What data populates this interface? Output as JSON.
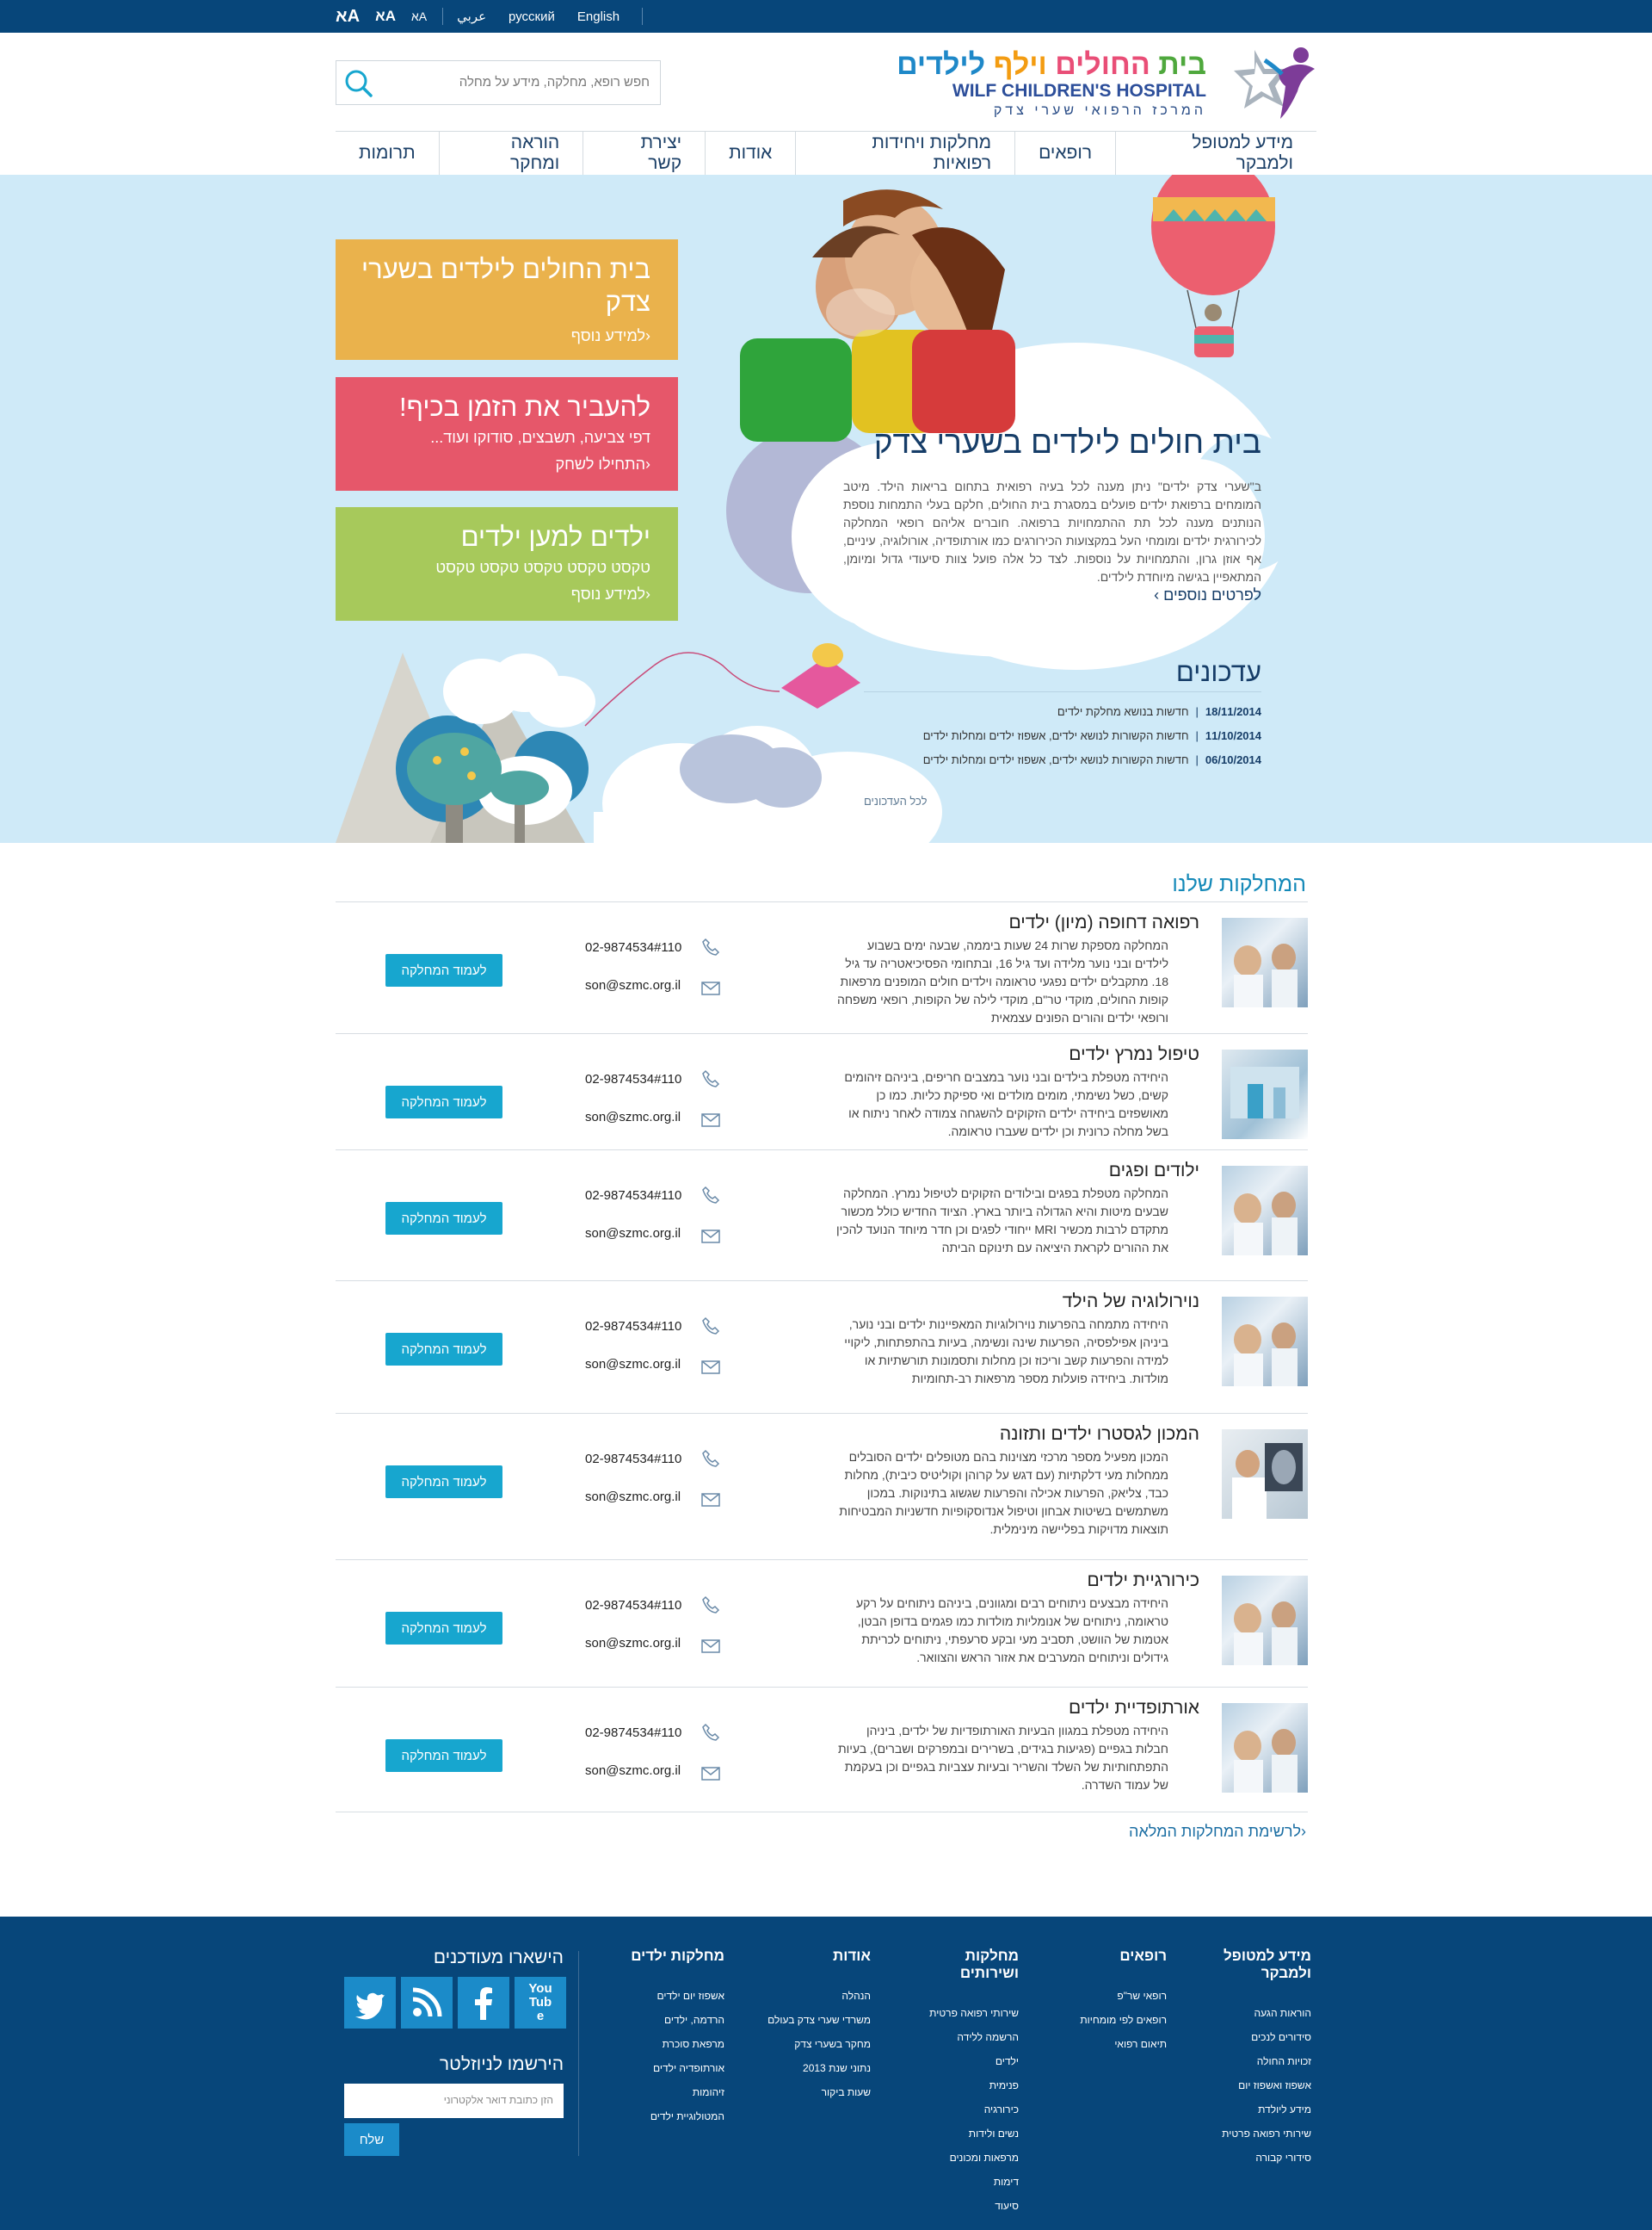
{
  "topbar": {
    "font_sizes": [
      "אA",
      "אA",
      "אA"
    ],
    "languages": [
      "عربي",
      "русский",
      "English"
    ]
  },
  "header": {
    "logo": {
      "title_he": "בית החולים וילף לילדים",
      "title_en": "WILF CHILDREN'S HOSPITAL",
      "subtitle_he": "המרכז הרפואי שערי צדק"
    },
    "search": {
      "placeholder": "חפש רופא, מחלקה, מידע על מחלה"
    }
  },
  "nav": [
    "מידע למטופל ולמבקר",
    "רופאים",
    "מחלקות ויחידות רפואיות",
    "אודות",
    "יצירת קשר",
    "הוראה ומחקר",
    "תרומות"
  ],
  "hero": {
    "boxes": [
      {
        "title": "בית החולים לילדים בשערי צדק",
        "sub": "",
        "more": "למידע נוסף"
      },
      {
        "title": "להעביר את הזמן בכיף!",
        "sub": "דפי צביעה, תשבצים, סודוקו ועוד...",
        "more": "התחילו לשחק"
      },
      {
        "title": "ילדים למען ילדים",
        "sub": "טקסט טקסט טקסט טקסט טקסט",
        "more": "למידע נוסף"
      }
    ],
    "cloud": {
      "title": "בית חולים לילדים בשערי צדק",
      "text": "ב\"שערי צדק ילדים\" ניתן מענה לכל בעיה רפואית בתחום בריאות הילד. מיטב המומחים ברפואת ילדים פועלים במסגרת בית החולים, חלקם בעלי התמחות נוספת הנותנים מענה לכל תת ההתמחויות ברפואה. חוברים אליהם רופאי המחלקה לכירורגית ילדים ומומחי העל במקצועות הכירורגים כמו אורתופדיה, אורולוגיה, עיניים, אף אוזן גרון, והתמחויות על נוספות. לצד כל אלה פועל צוות סיעודי גדול ומיומן, המתאפיין בגישה מיוחדת לילדים.",
      "more": "לפרטים נוספים"
    },
    "updates": {
      "title": "עדכונים",
      "items": [
        {
          "date": "18/11/2014",
          "text": "חדשות בנושא מחלקת ילדים"
        },
        {
          "date": "11/10/2014",
          "text": "חדשות הקשורות לנושא ילדים, אשפוז ילדים ומחלות ילדים"
        },
        {
          "date": "06/10/2014",
          "text": "חדשות הקשורות לנושא ילדים, אשפוז ילדים ומחלות ילדים"
        }
      ],
      "all": "לכל העדכונים"
    }
  },
  "departments": {
    "title": "המחלקות שלנו",
    "button_label": "לעמוד המחלקה",
    "items": [
      {
        "name": "רפואה דחופה (מיון) ילדים",
        "text": "המחלקה מספקת שרות 24 שעות ביממה, שבעה ימים בשבוע לילדים ובני נוער מלידה ועד גיל 16, ובתחומי הפסיכיאטריה עד גיל 18. מתקבלים ילדים נפגעי טראומה וילדים חולים המופנים מרפאות קופות החולים, מוקדי טר\"ם, מוקדי לילה של הקופות, רופאי משפחה ורופאי ילדים והורים הפונים עצמאית",
        "phone": "02-9874534#110",
        "email": "son@szmc.org.il"
      },
      {
        "name": "טיפול נמרץ ילדים",
        "text": "היחידה מטפלת בילדים ובני נוער במצבים חריפים, ביניהם זיהומים קשים, כשל נשימתי, מומים מולדים ואי ספיקת כליות. כמו כן מאושפזים ביחידה ילדים הזקוקים להשגחה צמודה לאחר ניתוח או בשל מחלה כרונית וכן ילדים שעברו טראומה.",
        "phone": "02-9874534#110",
        "email": "son@szmc.org.il"
      },
      {
        "name": "ילודים ופגים",
        "text": "המחלקה מטפלת בפגים ובילודים הזקוקים לטיפול נמרץ. המחלקה שבעים מיטות והיא הגדולה ביותר בארץ. הציוד החדיש כולל מכשור מתקדם לרבות מכשיר MRI ייחודי לפגים וכן חדר מיוחד הנועד להכין את ההורים לקראת היציאה עם תינוקם הביתה",
        "phone": "02-9874534#110",
        "email": "son@szmc.org.il"
      },
      {
        "name": "נוירולוגיה של הילד",
        "text": "היחידה מתמחה בהפרעות נוירולוגיות המאפיינות ילדים ובני נוער, ביניהן אפילפסיה, הפרעות שינה ונשימה, בעיות בהתפתחות, ליקויי למידה והפרעות קשב וריכוז וכן מחלות ותסמונות תורשתיות או מולדות. ביחידה פועלות מספר מרפאות רב-תחומיות",
        "phone": "02-9874534#110",
        "email": "son@szmc.org.il"
      },
      {
        "name": "המכון לגסטרו ילדים ותזונה",
        "text": "המכון מפעיל מספר מרכזי מצוינות בהם מטופלים ילדים הסובלים ממחלות מעי דלקתיות (עם דגש על קרוהן וקוליטיס כיבית), מחלות כבד, צליאק, הפרעות אכילה והפרעות שגשוג בתינוקות. במכון משתמשים בשיטות אבחון וטיפול אנדוסקופיות חדשניות המבטיחות תוצאות מדויקות בפליישה מינימלית.",
        "phone": "02-9874534#110",
        "email": "son@szmc.org.il"
      },
      {
        "name": "כירורגיית ילדים",
        "text": "היחידה מבצעים ניתוחים רבים ומגוונים, ביניהם ניתוחים על רקע טראומה, ניתוחים של אנומליות מולדות כמו פגמים בדופן הבטן, אטמות של הוושט, תסביב מעי ובקע סרעפתי, ניתוחים לכריתת גידולים וניתוחים המערבים את אזור הראש והצוואר.",
        "phone": "02-9874534#110",
        "email": "son@szmc.org.il"
      },
      {
        "name": "אורתופדיית ילדים",
        "text": "היחידה מטפלת במגוון הבעיות האורתופדיות של ילדים, ביניהן חבלות בגפיים (פגיעות בגידים, בשרירים ובמפרקים ושברים), בעיות התפתחותיות של השלד והשריר ובעיות עצביות בגפיים וכן בעקמת של עמוד השדרה.",
        "phone": "02-9874534#110",
        "email": "son@szmc.org.il"
      }
    ],
    "full_list": "לרשימת המחלקות המלאה"
  },
  "footer": {
    "columns": [
      {
        "title": "מידע למטופל ולמבקר",
        "links": [
          "הוראות הגעה",
          "סידורים לנכים",
          "זכויות החולה",
          "אשפוז ואשפוז יום",
          "מידע ליולדת",
          "שירותי רפואה פרטית",
          "סידורי קבורה"
        ]
      },
      {
        "title": "רופאים",
        "links": [
          "רופאי שר\"פ",
          "רופאים לפי מומחיות",
          "תיאום רפואי"
        ]
      },
      {
        "title": "מחלקות ושירותים",
        "links": [
          "שירותי רפואה פרטית",
          "הרשמה ללידה",
          "ילדים",
          "פנימית",
          "כירורגיה",
          "נשים ולידות",
          "מרפאות ומכונים",
          "דימות",
          "סיעוד"
        ]
      },
      {
        "title": "אודות",
        "links": [
          "הנהלה",
          "משרדי שערי צדק בעולם",
          "מחקר בשערי צדק",
          "נתוני שנת 2013",
          "שעות ביקור"
        ]
      },
      {
        "title": "מחלקות ילדים",
        "links": [
          "אשפוז יום ילדים",
          "הרדמה, ילדים",
          "מרפאת סוכרת",
          "אורתופדיה ילדים",
          "זיהומות",
          "המטולוגיית ילדים"
        ]
      }
    ],
    "social_title": "הישארו מעודכנים",
    "social": [
      "twitter-icon",
      "rss-icon",
      "facebook-icon",
      "youtube-icon"
    ],
    "youtube_label": "YouTube",
    "newsletter_title": "הירשמו לניוזלטר",
    "newsletter_placeholder": "הזן כתובת דואר אלקטרוני",
    "newsletter_button": "שלח"
  },
  "colors": {
    "topbar": "#07467a",
    "hero_bg": "#cfeaf8",
    "box_orange": "#eab24c",
    "box_red": "#e6576a",
    "box_green": "#a7c95b",
    "button": "#17a6cf",
    "footer": "#07467a"
  }
}
